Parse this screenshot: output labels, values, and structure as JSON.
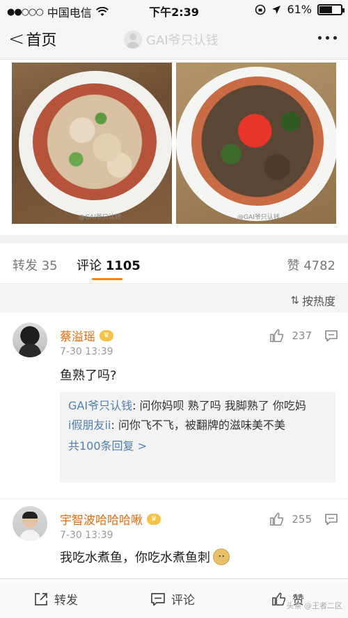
{
  "status_bar": {
    "signal": "●●○○○",
    "carrier": "中国电信",
    "wifi_icon": "wifi-icon",
    "time": "下午2:39",
    "battery": "61%",
    "battery_level": 0.61
  },
  "nav": {
    "back_label": "首页",
    "title": "GAI爷只认钱"
  },
  "photos": {
    "watermark_1": "@GAI爷只认钱",
    "watermark_2": "@GAI爷只认钱"
  },
  "tabs": {
    "repost_label": "转发",
    "repost_count": "35",
    "comment_label": "评论",
    "comment_count": "1105",
    "like_label": "赞",
    "like_count": "4782"
  },
  "sort": {
    "label": "按热度"
  },
  "comments": [
    {
      "user": "蔡溢瑶",
      "time": "7-30 13:39",
      "likes": "237",
      "text": "鱼熟了吗?",
      "replies": [
        {
          "user": "GAI爷只认钱",
          "text": ": 问你妈呗 熟了吗 我脚熟了 你吃妈"
        },
        {
          "user": "i假朋友ii",
          "text": ": 问你飞不飞，被翻牌的滋味美不美"
        }
      ],
      "more_replies": "共100条回复 >"
    },
    {
      "user": "宇智波哈哈哈啾",
      "time": "7-30 13:39",
      "likes": "255",
      "text": "我吃水煮鱼，你吃水煮鱼刺",
      "replies": []
    }
  ],
  "toolbar": {
    "repost": "转发",
    "comment": "评论",
    "like": "赞",
    "watermark": "头条 @王者二区"
  },
  "colors": {
    "accent": "#ff8200",
    "username": "#e86b0c",
    "link": "#4e7fb3"
  }
}
